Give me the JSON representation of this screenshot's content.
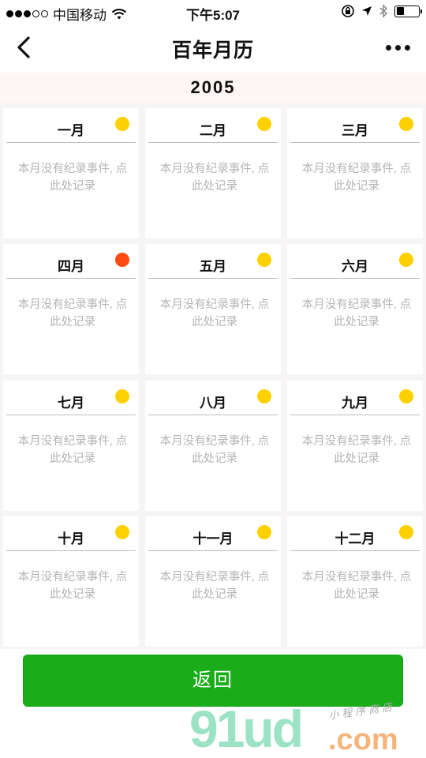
{
  "status_bar": {
    "carrier": "中国移动",
    "time": "下午5:07",
    "signal_strength": 3,
    "battery_level": 0.35
  },
  "nav": {
    "title": "百年月历",
    "back_icon": "chevron-left-icon",
    "more_icon": "ellipsis-icon"
  },
  "year": "2005",
  "months": [
    {
      "name": "一月",
      "note": "本月没有纪录事件, 点此处记录",
      "dot_color": "#fdd000"
    },
    {
      "name": "二月",
      "note": "本月没有纪录事件, 点此处记录",
      "dot_color": "#fdd000"
    },
    {
      "name": "三月",
      "note": "本月没有纪录事件, 点此处记录",
      "dot_color": "#fdd000"
    },
    {
      "name": "四月",
      "note": "本月没有纪录事件, 点此处记录",
      "dot_color": "#ff4a0f"
    },
    {
      "name": "五月",
      "note": "本月没有纪录事件, 点此处记录",
      "dot_color": "#fdd000"
    },
    {
      "name": "六月",
      "note": "本月没有纪录事件, 点此处记录",
      "dot_color": "#fdd000"
    },
    {
      "name": "七月",
      "note": "本月没有纪录事件, 点此处记录",
      "dot_color": "#fdd000"
    },
    {
      "name": "八月",
      "note": "本月没有纪录事件, 点此处记录",
      "dot_color": "#fdd000"
    },
    {
      "name": "九月",
      "note": "本月没有纪录事件, 点此处记录",
      "dot_color": "#fdd000"
    },
    {
      "name": "十月",
      "note": "本月没有纪录事件, 点此处记录",
      "dot_color": "#fdd000"
    },
    {
      "name": "十一月",
      "note": "本月没有纪录事件, 点此处记录",
      "dot_color": "#fdd000"
    },
    {
      "name": "十二月",
      "note": "本月没有纪录事件, 点此处记录",
      "dot_color": "#fdd000"
    }
  ],
  "back_button_label": "返回",
  "watermark": {
    "brand": "91ud",
    "domain": ".com",
    "tagline": "小程序商店"
  },
  "colors": {
    "accent_green": "#1aad19",
    "year_band": "#fdf6f4",
    "note_text": "#b4b4b4"
  }
}
